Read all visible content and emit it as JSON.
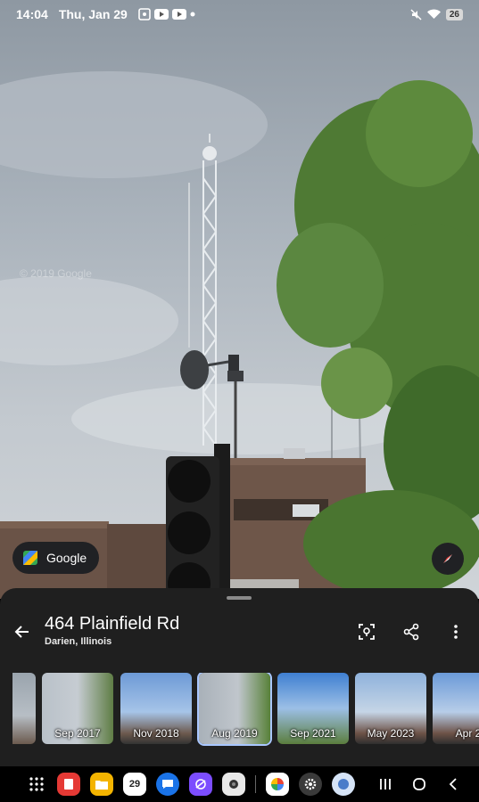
{
  "status_bar": {
    "time": "14:04",
    "date": "Thu, Jan 29",
    "battery": "26"
  },
  "streetview": {
    "watermark": "© 2019 Google",
    "google_chip_label": "Google"
  },
  "place": {
    "title": "464 Plainfield Rd",
    "subtitle": "Darien, Illinois"
  },
  "timeline": [
    {
      "label": "",
      "selected": false
    },
    {
      "label": "Sep 2017",
      "selected": false
    },
    {
      "label": "Nov 2018",
      "selected": false
    },
    {
      "label": "Aug 2019",
      "selected": true
    },
    {
      "label": "Sep 2021",
      "selected": false
    },
    {
      "label": "May 2023",
      "selected": false
    },
    {
      "label": "Apr 2",
      "selected": false
    }
  ],
  "taskbar": {
    "calendar_day": "29"
  },
  "colors": {
    "sheet_bg": "#1f1f1f",
    "selected_outline": "#a9c7ff"
  }
}
